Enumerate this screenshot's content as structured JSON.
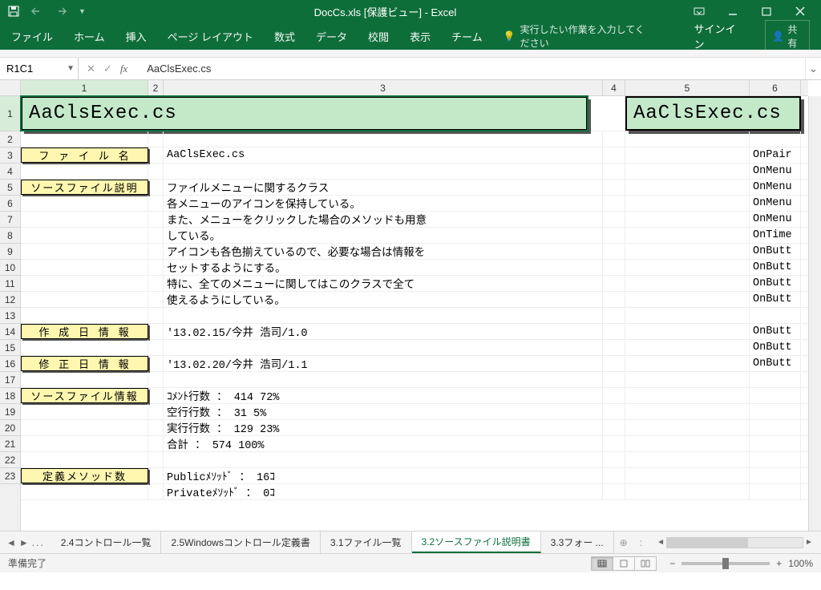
{
  "title_bar": {
    "title": "DocCs.xls  [保護ビュー] - Excel"
  },
  "ribbon": {
    "tabs": [
      "ファイル",
      "ホーム",
      "挿入",
      "ページ レイアウト",
      "数式",
      "データ",
      "校閲",
      "表示",
      "チーム"
    ],
    "tell_me": "実行したい作業を入力してください",
    "signin": "サインイン",
    "share": "共有"
  },
  "formula_bar": {
    "name_box": "R1C1",
    "formula": "AaClsExec.cs"
  },
  "columns": [
    "1",
    "2",
    "3",
    "4",
    "5",
    "6"
  ],
  "rows": [
    "1",
    "2",
    "3",
    "4",
    "5",
    "6",
    "7",
    "8",
    "9",
    "10",
    "11",
    "12",
    "13",
    "14",
    "15",
    "16",
    "17",
    "18",
    "19",
    "20",
    "21",
    "22",
    "23"
  ],
  "sheet": {
    "title1": "AaClsExec.cs",
    "title5": "AaClsExec.cs",
    "labels": {
      "r3": "フ ァ イ ル 名",
      "r5": "ソースファイル説明",
      "r14": "作 成 日 情 報",
      "r16": "修 正 日 情 報",
      "r18": "ソースファイル情報",
      "r23": "定義メソッド数"
    },
    "c3": {
      "r3": "AaClsExec.cs",
      "r5": "ファイルメニューに関するクラス",
      "r6": "各メニューのアイコンを保持している。",
      "r7": "また、メニューをクリックした場合のメソッドも用意",
      "r8": "している。",
      "r9": "アイコンも各色揃えているので、必要な場合は情報を",
      "r10": "セットするようにする。",
      "r11": "特に、全てのメニューに関してはこのクラスで全て",
      "r12": "使えるようにしている。",
      "r14": "'13.02.15/今井 浩司/1.0",
      "r16": "'13.02.20/今井 浩司/1.1",
      "r18": "ｺﾒﾝﾄ行数  ：    414    72%",
      "r19": "空行行数  ：     31     5%",
      "r20": "実行行数  ：    129    23%",
      "r21": "合計      ：    574   100%",
      "r23": "Publicﾒｿｯﾄﾞ       ：  16ｺ",
      "r24": "Privateﾒｿｯﾄﾞ      ：   0ｺ"
    },
    "c6": {
      "r3": "OnPair",
      "r4": "OnMenu",
      "r5": "OnMenu",
      "r6": "OnMenu",
      "r7": "OnMenu",
      "r8": "OnTime",
      "r9": "OnButt",
      "r10": "OnButt",
      "r11": "OnButt",
      "r12": "OnButt",
      "r14": "OnButt",
      "r15": "OnButt",
      "r16": "OnButt"
    }
  },
  "sheet_tabs": {
    "items": [
      "2.4コントロール一覧",
      "2.5Windowsコントロール定義書",
      "3.1ファイル一覧",
      "3.2ソースファイル説明書",
      "3.3フォー ..."
    ],
    "active_index": 3,
    "ellipsis_left": "...",
    "ellipsis_right": "...",
    "separator": ":"
  },
  "status_bar": {
    "ready": "準備完了",
    "zoom": "100%",
    "minus": "−",
    "plus": "+"
  }
}
